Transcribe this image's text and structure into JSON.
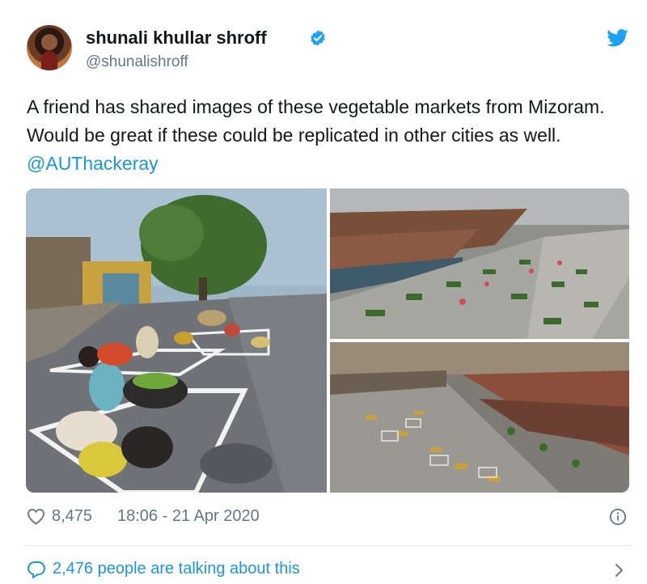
{
  "author": {
    "display_name": "shunali khullar shroff",
    "handle": "@shunalishroff"
  },
  "tweet": {
    "text": "A friend has shared images of these vegetable markets from Mizoram. Would be great if these could be replicated in other cities as well. ",
    "mention": "@AUThackeray"
  },
  "stats": {
    "likes": "8,475",
    "timestamp": "18:06 - 21 Apr 2020"
  },
  "conversation": {
    "label": "2,476 people are talking about this"
  },
  "icons": {
    "verified": "verified-badge-icon",
    "brand": "twitter-bird-icon",
    "like": "heart-icon",
    "info": "info-icon",
    "reply": "speech-bubble-icon",
    "chevron": "chevron-right-icon"
  },
  "colors": {
    "link": "#1b95e0",
    "muted": "#657786",
    "text": "#14171a",
    "divider": "#e1e8ed"
  }
}
